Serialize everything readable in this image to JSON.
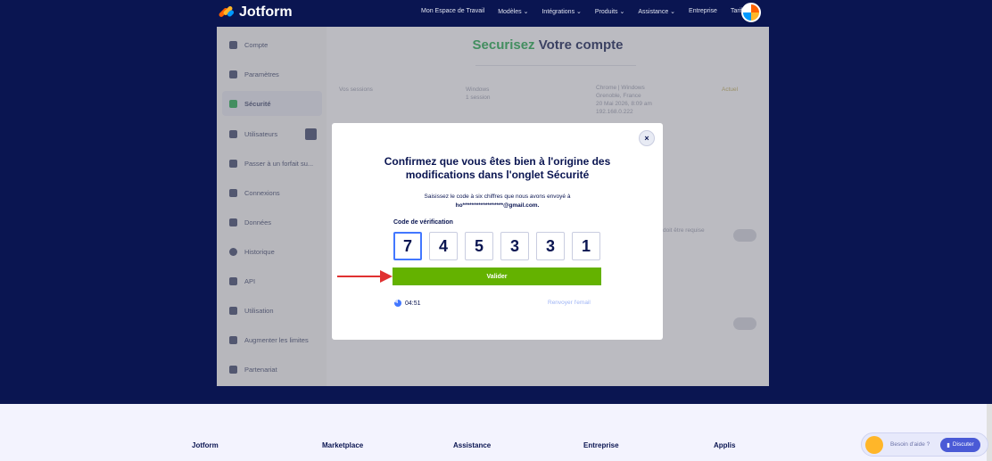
{
  "topnav": {
    "logo": "Jotform",
    "items": [
      "Mon Espace de Travail",
      "Modèles ⌄",
      "Intégrations ⌄",
      "Produits ⌄",
      "Assistance ⌄",
      "Entreprise",
      "Tarifs"
    ]
  },
  "sidebar": {
    "items": [
      {
        "label": "Compte"
      },
      {
        "label": "Paramètres"
      },
      {
        "label": "Sécurité"
      },
      {
        "label": "Utilisateurs"
      },
      {
        "label": "Passer à un forfait su..."
      },
      {
        "label": "Connexions"
      },
      {
        "label": "Données"
      },
      {
        "label": "Historique"
      },
      {
        "label": "API"
      },
      {
        "label": "Utilisation"
      },
      {
        "label": "Augmenter les limites"
      },
      {
        "label": "Partenariat"
      }
    ]
  },
  "content": {
    "title_green": "Securisez",
    "title_rest": " Votre compte",
    "sessions_label": "Vos sessions",
    "device": "Windows",
    "device_sub": "1 session",
    "browser": "Chrome | Windows",
    "location": "Grenoble, France",
    "date": "20 Mai 2026, 8:09 am",
    "ip": "192.168.0.222",
    "current_badge": "Actuel",
    "two_factor_hint": "doit être requise"
  },
  "modal": {
    "close": "×",
    "title": "Confirmez que vous êtes bien à l'origine des modifications dans l'onglet Sécurité",
    "subtitle": "Saisissez le code à six chiffres que nous avons envoyé à",
    "email": "ho******************@gmail.com.",
    "code_label": "Code de vérification",
    "digits": [
      "7",
      "4",
      "5",
      "3",
      "3",
      "1"
    ],
    "validate": "Valider",
    "timer": "04:51",
    "resend": "Renvoyer l'email"
  },
  "footer": {
    "columns": [
      "Jotform",
      "Marketplace",
      "Assistance",
      "Entreprise",
      "Applis"
    ]
  },
  "help": {
    "text": "Besoin d'aide ?",
    "chat": "Discuter"
  },
  "colors": {
    "navy": "#0a1551",
    "green_button": "#64b200",
    "title_green": "#18a04d",
    "arrow_red": "#e03131"
  }
}
